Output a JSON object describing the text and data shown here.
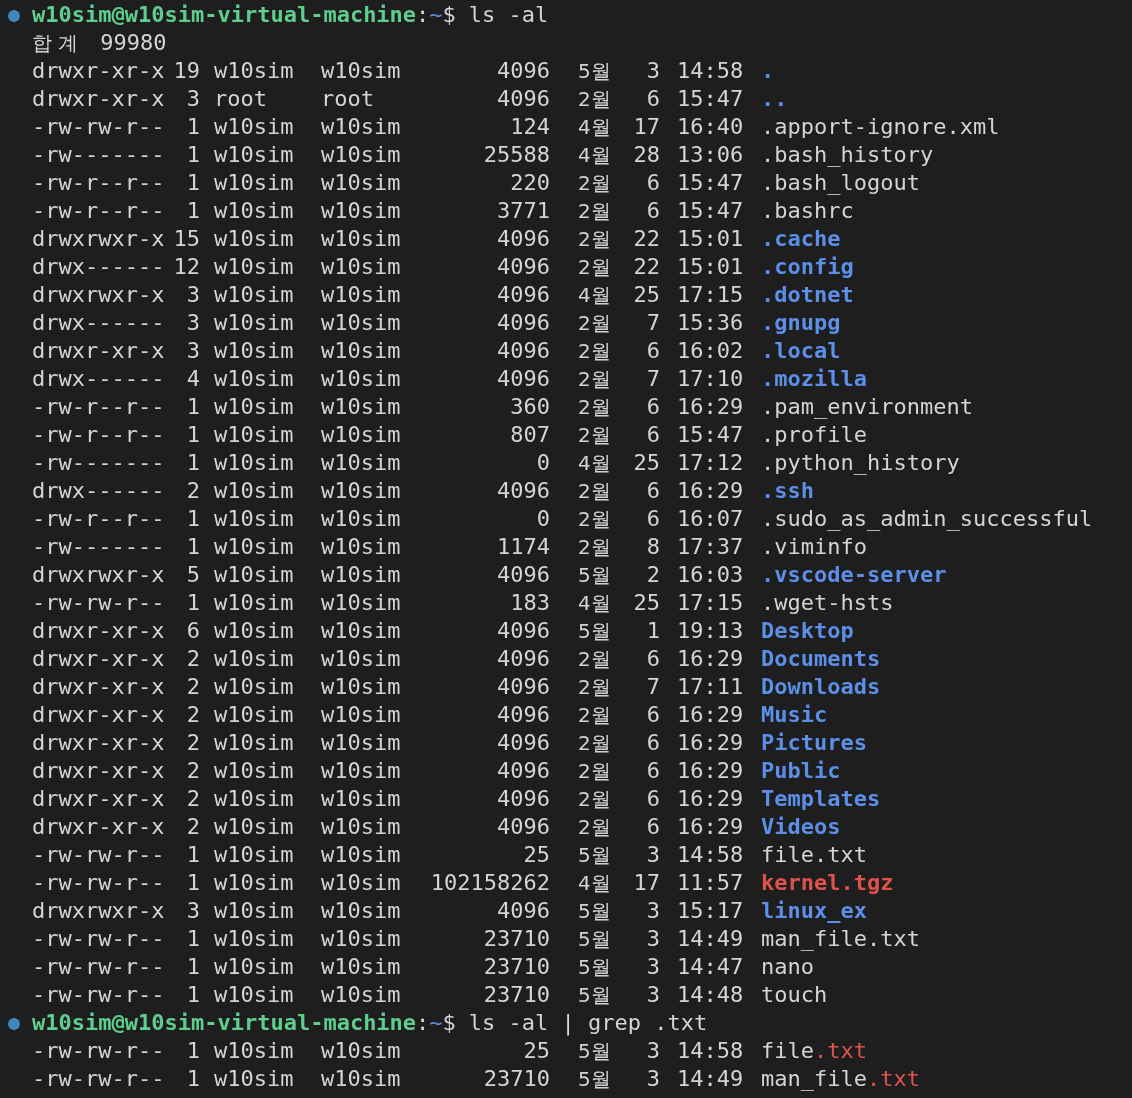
{
  "blocks": [
    {
      "prompt": {
        "user_host": "w10sim@w10sim-virtual-machine",
        "separator": ":",
        "path": "~",
        "symbol": "$",
        "command": "ls -al"
      },
      "total": {
        "label": "합 계",
        "value": "99980"
      },
      "rows": [
        {
          "perms": "drwxr-xr-x",
          "links": "19",
          "owner": "w10sim",
          "group": "w10sim",
          "size": "4096",
          "month": "5월",
          "day": "3",
          "time": "14:58",
          "name": ".",
          "kind": "dir"
        },
        {
          "perms": "drwxr-xr-x",
          "links": "3",
          "owner": "root",
          "group": "root",
          "size": "4096",
          "month": "2월",
          "day": "6",
          "time": "15:47",
          "name": "..",
          "kind": "dir"
        },
        {
          "perms": "-rw-rw-r--",
          "links": "1",
          "owner": "w10sim",
          "group": "w10sim",
          "size": "124",
          "month": "4월",
          "day": "17",
          "time": "16:40",
          "name": ".apport-ignore.xml",
          "kind": "file"
        },
        {
          "perms": "-rw-------",
          "links": "1",
          "owner": "w10sim",
          "group": "w10sim",
          "size": "25588",
          "month": "4월",
          "day": "28",
          "time": "13:06",
          "name": ".bash_history",
          "kind": "file"
        },
        {
          "perms": "-rw-r--r--",
          "links": "1",
          "owner": "w10sim",
          "group": "w10sim",
          "size": "220",
          "month": "2월",
          "day": "6",
          "time": "15:47",
          "name": ".bash_logout",
          "kind": "file"
        },
        {
          "perms": "-rw-r--r--",
          "links": "1",
          "owner": "w10sim",
          "group": "w10sim",
          "size": "3771",
          "month": "2월",
          "day": "6",
          "time": "15:47",
          "name": ".bashrc",
          "kind": "file"
        },
        {
          "perms": "drwxrwxr-x",
          "links": "15",
          "owner": "w10sim",
          "group": "w10sim",
          "size": "4096",
          "month": "2월",
          "day": "22",
          "time": "15:01",
          "name": ".cache",
          "kind": "dir"
        },
        {
          "perms": "drwx------",
          "links": "12",
          "owner": "w10sim",
          "group": "w10sim",
          "size": "4096",
          "month": "2월",
          "day": "22",
          "time": "15:01",
          "name": ".config",
          "kind": "dir"
        },
        {
          "perms": "drwxrwxr-x",
          "links": "3",
          "owner": "w10sim",
          "group": "w10sim",
          "size": "4096",
          "month": "4월",
          "day": "25",
          "time": "17:15",
          "name": ".dotnet",
          "kind": "dir"
        },
        {
          "perms": "drwx------",
          "links": "3",
          "owner": "w10sim",
          "group": "w10sim",
          "size": "4096",
          "month": "2월",
          "day": "7",
          "time": "15:36",
          "name": ".gnupg",
          "kind": "dir"
        },
        {
          "perms": "drwxr-xr-x",
          "links": "3",
          "owner": "w10sim",
          "group": "w10sim",
          "size": "4096",
          "month": "2월",
          "day": "6",
          "time": "16:02",
          "name": ".local",
          "kind": "dir"
        },
        {
          "perms": "drwx------",
          "links": "4",
          "owner": "w10sim",
          "group": "w10sim",
          "size": "4096",
          "month": "2월",
          "day": "7",
          "time": "17:10",
          "name": ".mozilla",
          "kind": "dir"
        },
        {
          "perms": "-rw-r--r--",
          "links": "1",
          "owner": "w10sim",
          "group": "w10sim",
          "size": "360",
          "month": "2월",
          "day": "6",
          "time": "16:29",
          "name": ".pam_environment",
          "kind": "file"
        },
        {
          "perms": "-rw-r--r--",
          "links": "1",
          "owner": "w10sim",
          "group": "w10sim",
          "size": "807",
          "month": "2월",
          "day": "6",
          "time": "15:47",
          "name": ".profile",
          "kind": "file"
        },
        {
          "perms": "-rw-------",
          "links": "1",
          "owner": "w10sim",
          "group": "w10sim",
          "size": "0",
          "month": "4월",
          "day": "25",
          "time": "17:12",
          "name": ".python_history",
          "kind": "file"
        },
        {
          "perms": "drwx------",
          "links": "2",
          "owner": "w10sim",
          "group": "w10sim",
          "size": "4096",
          "month": "2월",
          "day": "6",
          "time": "16:29",
          "name": ".ssh",
          "kind": "dir"
        },
        {
          "perms": "-rw-r--r--",
          "links": "1",
          "owner": "w10sim",
          "group": "w10sim",
          "size": "0",
          "month": "2월",
          "day": "6",
          "time": "16:07",
          "name": ".sudo_as_admin_successful",
          "kind": "file"
        },
        {
          "perms": "-rw-------",
          "links": "1",
          "owner": "w10sim",
          "group": "w10sim",
          "size": "1174",
          "month": "2월",
          "day": "8",
          "time": "17:37",
          "name": ".viminfo",
          "kind": "file"
        },
        {
          "perms": "drwxrwxr-x",
          "links": "5",
          "owner": "w10sim",
          "group": "w10sim",
          "size": "4096",
          "month": "5월",
          "day": "2",
          "time": "16:03",
          "name": ".vscode-server",
          "kind": "dir"
        },
        {
          "perms": "-rw-rw-r--",
          "links": "1",
          "owner": "w10sim",
          "group": "w10sim",
          "size": "183",
          "month": "4월",
          "day": "25",
          "time": "17:15",
          "name": ".wget-hsts",
          "kind": "file"
        },
        {
          "perms": "drwxr-xr-x",
          "links": "6",
          "owner": "w10sim",
          "group": "w10sim",
          "size": "4096",
          "month": "5월",
          "day": "1",
          "time": "19:13",
          "name": "Desktop",
          "kind": "dir"
        },
        {
          "perms": "drwxr-xr-x",
          "links": "2",
          "owner": "w10sim",
          "group": "w10sim",
          "size": "4096",
          "month": "2월",
          "day": "6",
          "time": "16:29",
          "name": "Documents",
          "kind": "dir"
        },
        {
          "perms": "drwxr-xr-x",
          "links": "2",
          "owner": "w10sim",
          "group": "w10sim",
          "size": "4096",
          "month": "2월",
          "day": "7",
          "time": "17:11",
          "name": "Downloads",
          "kind": "dir"
        },
        {
          "perms": "drwxr-xr-x",
          "links": "2",
          "owner": "w10sim",
          "group": "w10sim",
          "size": "4096",
          "month": "2월",
          "day": "6",
          "time": "16:29",
          "name": "Music",
          "kind": "dir"
        },
        {
          "perms": "drwxr-xr-x",
          "links": "2",
          "owner": "w10sim",
          "group": "w10sim",
          "size": "4096",
          "month": "2월",
          "day": "6",
          "time": "16:29",
          "name": "Pictures",
          "kind": "dir"
        },
        {
          "perms": "drwxr-xr-x",
          "links": "2",
          "owner": "w10sim",
          "group": "w10sim",
          "size": "4096",
          "month": "2월",
          "day": "6",
          "time": "16:29",
          "name": "Public",
          "kind": "dir"
        },
        {
          "perms": "drwxr-xr-x",
          "links": "2",
          "owner": "w10sim",
          "group": "w10sim",
          "size": "4096",
          "month": "2월",
          "day": "6",
          "time": "16:29",
          "name": "Templates",
          "kind": "dir"
        },
        {
          "perms": "drwxr-xr-x",
          "links": "2",
          "owner": "w10sim",
          "group": "w10sim",
          "size": "4096",
          "month": "2월",
          "day": "6",
          "time": "16:29",
          "name": "Videos",
          "kind": "dir"
        },
        {
          "perms": "-rw-rw-r--",
          "links": "1",
          "owner": "w10sim",
          "group": "w10sim",
          "size": "25",
          "month": "5월",
          "day": "3",
          "time": "14:58",
          "name": "file.txt",
          "kind": "file"
        },
        {
          "perms": "-rw-rw-r--",
          "links": "1",
          "owner": "w10sim",
          "group": "w10sim",
          "size": "102158262",
          "month": "4월",
          "day": "17",
          "time": "11:57",
          "name": "kernel.tgz",
          "kind": "archive"
        },
        {
          "perms": "drwxrwxr-x",
          "links": "3",
          "owner": "w10sim",
          "group": "w10sim",
          "size": "4096",
          "month": "5월",
          "day": "3",
          "time": "15:17",
          "name": "linux_ex",
          "kind": "dir"
        },
        {
          "perms": "-rw-rw-r--",
          "links": "1",
          "owner": "w10sim",
          "group": "w10sim",
          "size": "23710",
          "month": "5월",
          "day": "3",
          "time": "14:49",
          "name": "man_file.txt",
          "kind": "file"
        },
        {
          "perms": "-rw-rw-r--",
          "links": "1",
          "owner": "w10sim",
          "group": "w10sim",
          "size": "23710",
          "month": "5월",
          "day": "3",
          "time": "14:47",
          "name": "nano",
          "kind": "file"
        },
        {
          "perms": "-rw-rw-r--",
          "links": "1",
          "owner": "w10sim",
          "group": "w10sim",
          "size": "23710",
          "month": "5월",
          "day": "3",
          "time": "14:48",
          "name": "touch",
          "kind": "file"
        }
      ]
    },
    {
      "prompt": {
        "user_host": "w10sim@w10sim-virtual-machine",
        "separator": ":",
        "path": "~",
        "symbol": "$",
        "command": "ls -al | grep .txt"
      },
      "rows": [
        {
          "perms": "-rw-rw-r--",
          "links": "1",
          "owner": "w10sim",
          "group": "w10sim",
          "size": "25",
          "month": "5월",
          "day": "3",
          "time": "14:58",
          "name": "file",
          "match": ".txt",
          "kind": "file"
        },
        {
          "perms": "-rw-rw-r--",
          "links": "1",
          "owner": "w10sim",
          "group": "w10sim",
          "size": "23710",
          "month": "5월",
          "day": "3",
          "time": "14:49",
          "name": "man_file",
          "match": ".txt",
          "kind": "file"
        }
      ]
    }
  ]
}
